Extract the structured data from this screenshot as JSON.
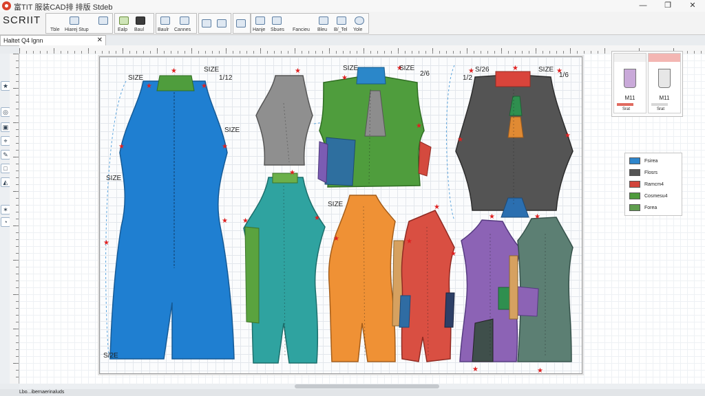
{
  "window": {
    "title": "富TIT 服装CAD排   排版  Stdeb",
    "controls": {
      "minimize": "—",
      "maximize": "❐",
      "close": "✕"
    }
  },
  "ribbon": {
    "brand": "SCRIIT",
    "buttons": [
      {
        "label": "Tble",
        "icon": "text-tool-icon"
      },
      {
        "label": "Hiarej Stup",
        "icon": "arrow-up-icon"
      },
      {
        "label": "",
        "icon": "grid-icon"
      },
      {
        "label": "Ealp",
        "icon": "color-swatch-icon"
      },
      {
        "label": "Baul",
        "icon": "dark-piece-icon"
      },
      {
        "label": "Baulr",
        "icon": "hanger-icon"
      },
      {
        "label": "Cannes",
        "icon": "layers-icon"
      },
      {
        "label": "",
        "icon": "piece-outline-icon"
      },
      {
        "label": "",
        "icon": "shield-icon"
      },
      {
        "label": "",
        "icon": "window-icon"
      },
      {
        "label": "Hanje",
        "icon": "needle-icon"
      },
      {
        "label": "Sbues",
        "icon": "scissors-icon"
      },
      {
        "label": "Fancieu",
        "icon": "marker-icon"
      },
      {
        "label": "Bleu",
        "icon": "pencil-icon"
      },
      {
        "label": "B/_Tel",
        "icon": "ruler-icon"
      },
      {
        "label": "Yole",
        "icon": "globe-icon"
      }
    ]
  },
  "document_tab": {
    "label": "Haltet Q4 lgnn",
    "close": "✕"
  },
  "left_tools": [
    "★",
    "◎",
    "▣",
    "⌖",
    "✎",
    "□",
    "◭",
    "✶",
    "◔"
  ],
  "size_labels": [
    "SIZE",
    "1/12",
    "SIZE",
    "SIZE",
    "SIZE",
    "2/6",
    "1/2",
    "SIZE",
    "SIZE",
    "S/26",
    "SIZE",
    "1/6",
    "S/2E",
    "SIZE"
  ],
  "pattern_pieces": [
    {
      "name": "long-jumpsuit-blue",
      "color": "#1f7fd1"
    },
    {
      "name": "sleeveless-top-gray",
      "color": "#8f8f8f"
    },
    {
      "name": "green-bodice",
      "color": "#4f9d3d"
    },
    {
      "name": "dark-gray-vest",
      "color": "#545454"
    },
    {
      "name": "teal-jumpsuit",
      "color": "#2fa3a0"
    },
    {
      "name": "orange-dress",
      "color": "#ef9135"
    },
    {
      "name": "red-dress",
      "color": "#d94f42"
    },
    {
      "name": "purple-dress",
      "color": "#8c63b5"
    },
    {
      "name": "slate-dress",
      "color": "#5c7f73"
    }
  ],
  "thumbnails": [
    {
      "caption": "M11",
      "sub": "Srat"
    },
    {
      "caption": "M11",
      "sub": "Srat"
    }
  ],
  "legend": [
    {
      "label": "Fsirea",
      "color": "#2f86cc"
    },
    {
      "label": "Flosrs",
      "color": "#555555"
    },
    {
      "label": "Ramcm4",
      "color": "#d2453c"
    },
    {
      "label": "Cosmesu4",
      "color": "#4e9a3d"
    },
    {
      "label": "Forea",
      "color": "#5f9e4e"
    }
  ],
  "status": {
    "text": "Lbo...ibernaerinaluds"
  },
  "colors": {
    "marker": "#e02020",
    "sheet_border": "#9a9a9a"
  }
}
